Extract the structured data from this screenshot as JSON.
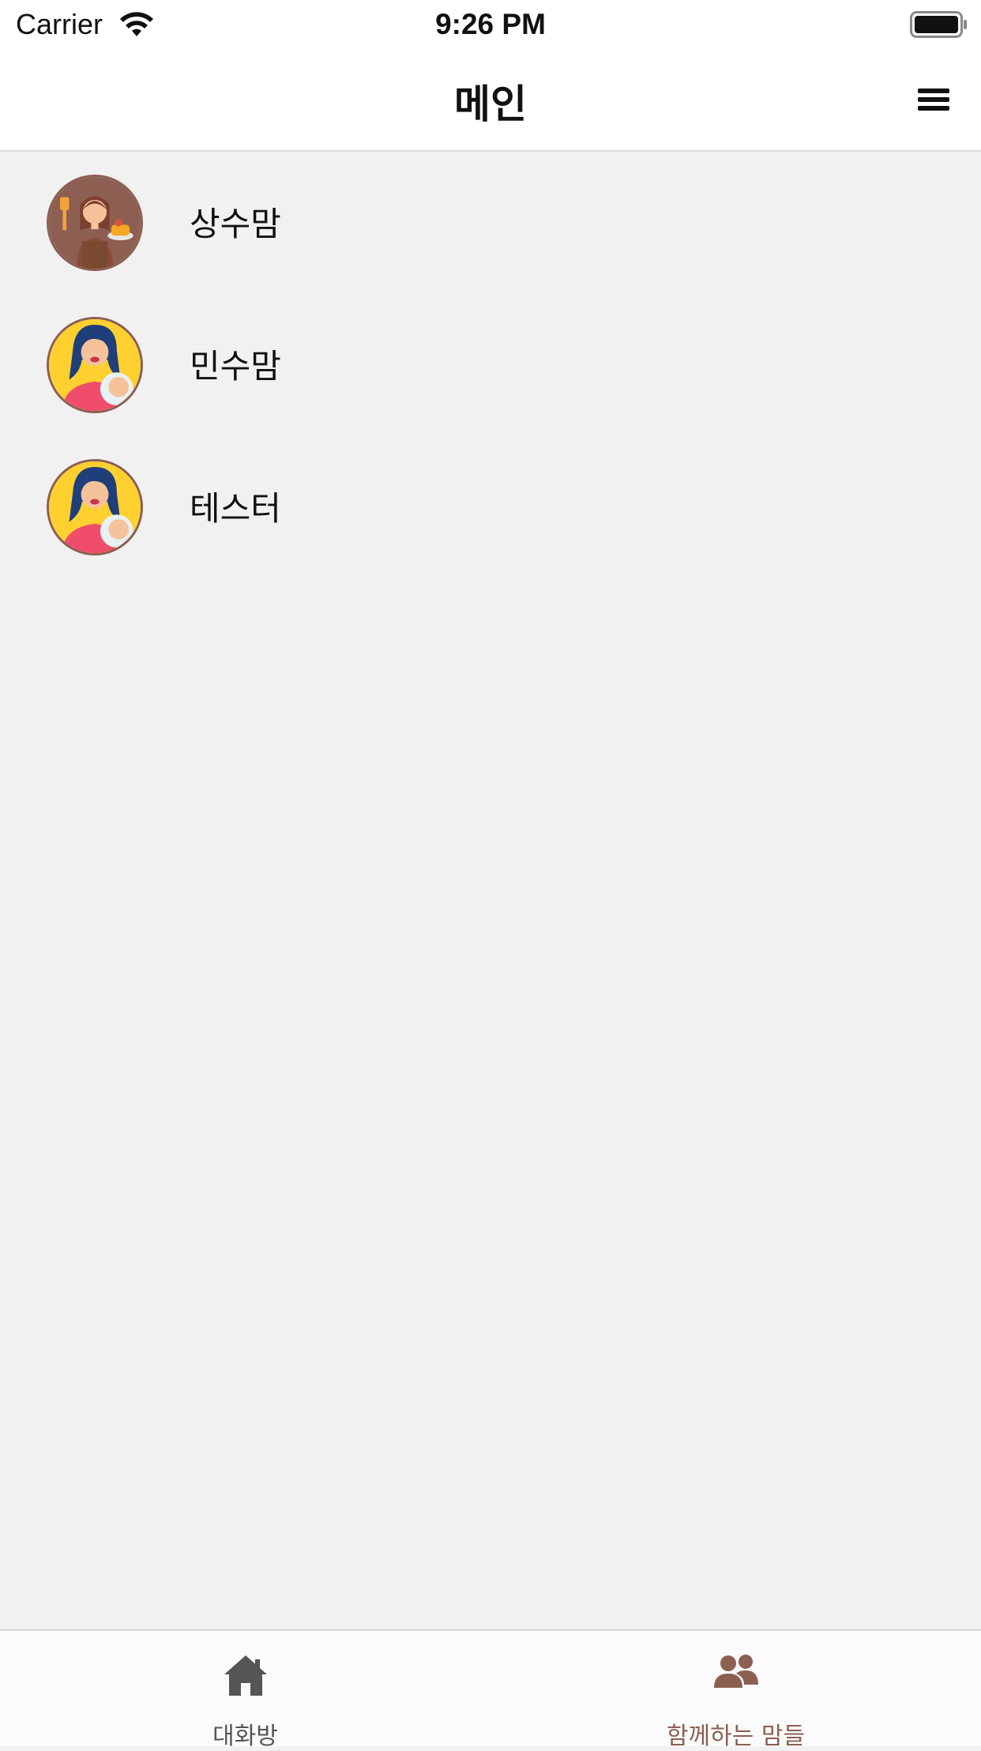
{
  "status_bar": {
    "carrier": "Carrier",
    "time": "9:26 PM",
    "wifi_icon": "wifi-icon",
    "battery_icon": "battery-full-icon"
  },
  "nav": {
    "title": "메인",
    "menu_icon": "hamburger-menu-icon"
  },
  "members": [
    {
      "name": "상수맘",
      "avatar": "woman-cooking-avatar"
    },
    {
      "name": "민수맘",
      "avatar": "mother-with-baby-avatar"
    },
    {
      "name": "테스터",
      "avatar": "mother-with-baby-avatar"
    }
  ],
  "tabs": [
    {
      "label": "대화방",
      "icon": "home-icon",
      "active": false
    },
    {
      "label": "함께하는 맘들",
      "icon": "people-icon",
      "active": true
    }
  ],
  "colors": {
    "accent": "#8d5f52",
    "inactive_tab": "#555555",
    "background": "#f1f1f1"
  }
}
